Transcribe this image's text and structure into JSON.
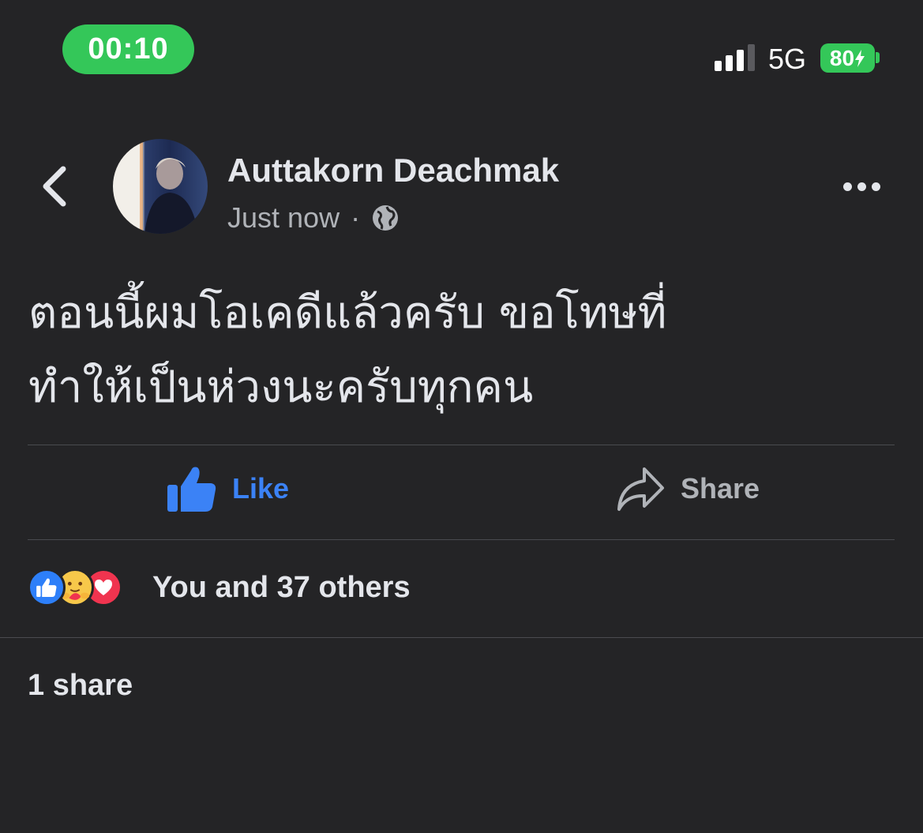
{
  "status_bar": {
    "time": "00:10",
    "network": "5G",
    "battery": "80",
    "signal_bars_active": 3,
    "signal_bars_total": 4
  },
  "post": {
    "author": "Auttakorn Deachmak",
    "timestamp": "Just now",
    "separator": "·",
    "audience_icon": "globe-icon",
    "text_lines": [
      "ตอนนี้ผมโอเคดีแล้วครับ ขอโทษที่",
      "ทำให้เป็นห่วงนะครับทุกคน"
    ]
  },
  "actions": {
    "like_label": "Like",
    "share_label": "Share"
  },
  "reactions": {
    "icons": [
      "like-reaction-icon",
      "care-reaction-icon",
      "love-reaction-icon"
    ],
    "summary": "You and 37 others"
  },
  "shares": "1 share",
  "colors": {
    "background": "#242426",
    "like_blue": "#3b82f6",
    "status_green": "#34c759",
    "secondary_text": "#b0b3b8"
  }
}
